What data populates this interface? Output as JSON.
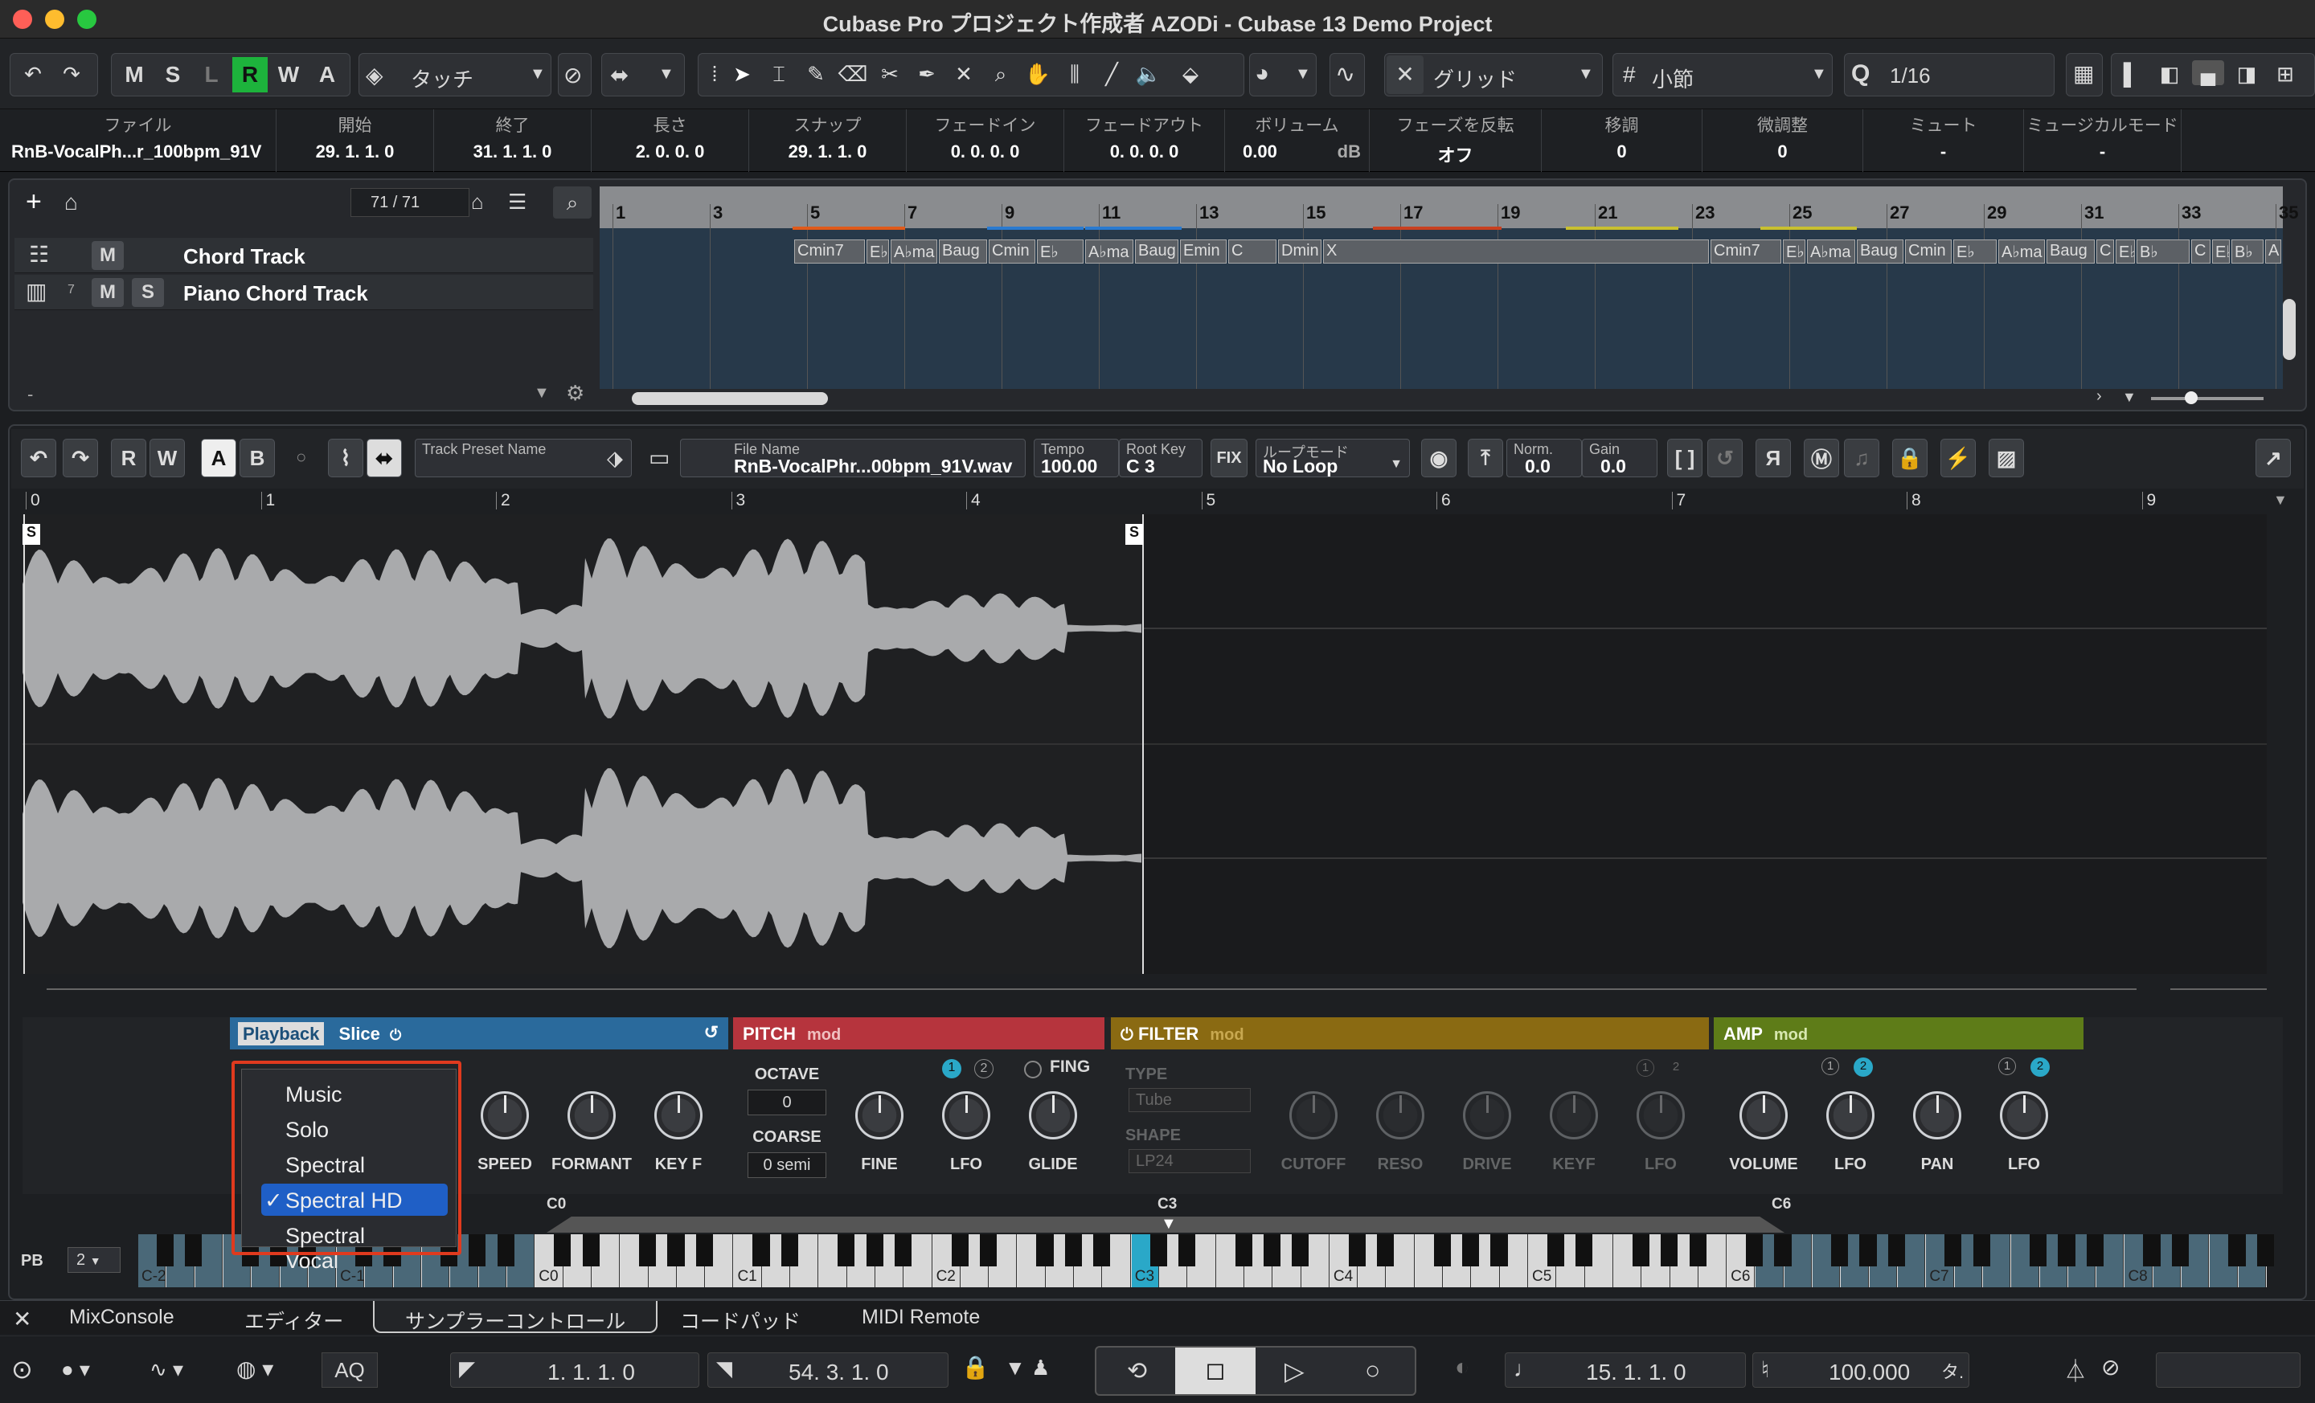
{
  "window": {
    "title": "Cubase Pro プロジェクト作成者 AZODi - Cubase 13 Demo Project"
  },
  "toolbar": {
    "modes": [
      "M",
      "S",
      "L",
      "R",
      "W",
      "A"
    ],
    "automation_mode": "タッチ",
    "snap_type": "グリッド",
    "grid_unit": "小節",
    "quantize": "1/16"
  },
  "infoline": [
    {
      "label": "ファイル",
      "value": "RnB-VocalPh...r_100bpm_91V"
    },
    {
      "label": "開始",
      "value": "29. 1. 1.   0"
    },
    {
      "label": "終了",
      "value": "31. 1. 1.   0"
    },
    {
      "label": "長さ",
      "value": "2. 0. 0.   0"
    },
    {
      "label": "スナップ",
      "value": "29. 1. 1.   0"
    },
    {
      "label": "フェードイン",
      "value": "0. 0. 0.   0"
    },
    {
      "label": "フェードアウト",
      "value": "0. 0. 0.   0"
    },
    {
      "label": "ボリューム",
      "value": "0.00",
      "unit": "dB"
    },
    {
      "label": "フェーズを反転",
      "value": "オフ"
    },
    {
      "label": "移調",
      "value": "0"
    },
    {
      "label": "微調整",
      "value": "0"
    },
    {
      "label": "ミュート",
      "value": "-"
    },
    {
      "label": "ミュージカルモード",
      "value": "-"
    }
  ],
  "project": {
    "track_count": "71 / 71",
    "tracks": [
      {
        "name": "Chord Track",
        "buttons": [
          "M"
        ]
      },
      {
        "name": "Piano Chord Track",
        "number": "7",
        "buttons": [
          "M",
          "S"
        ]
      }
    ],
    "ruler_bars": [
      "1",
      "3",
      "5",
      "7",
      "9",
      "11",
      "13",
      "15",
      "17",
      "19",
      "21",
      "23",
      "25",
      "27",
      "29",
      "31",
      "33",
      "35"
    ],
    "chords": [
      "Cmin7",
      "E♭",
      "A♭ma",
      "Baug",
      "Cmin",
      "E♭",
      "A♭ma",
      "Baug",
      "Emin",
      "C",
      "Dmin",
      "X",
      "Cmin7",
      "E♭",
      "A♭ma",
      "Baug",
      "Cmin",
      "E♭",
      "A♭ma",
      "Baug",
      "C",
      "E♭",
      "B♭",
      "C",
      "E♭",
      "B♭",
      "A"
    ],
    "dash": "-"
  },
  "editor": {
    "toolbar": {
      "r": "R",
      "w": "W",
      "a": "A",
      "b": "B",
      "track_preset_label": "Track Preset Name",
      "file_name_label": "File Name",
      "file_name": "RnB-VocalPhr...00bpm_91V.wav",
      "tempo_label": "Tempo",
      "tempo": "100.00",
      "root_key_label": "Root Key",
      "root_key": "C  3",
      "fix": "FIX",
      "loop_mode_label": "ループモード",
      "loop_mode": "No Loop",
      "norm_label": "Norm.",
      "norm": "0.0",
      "gain_label": "Gain",
      "gain": "0.0"
    },
    "ruler": [
      "0",
      "1",
      "2",
      "3",
      "4",
      "5",
      "6",
      "7",
      "8",
      "9"
    ],
    "markers": {
      "start": "S",
      "end": "S"
    },
    "playback": {
      "tab1": "Playback",
      "tab2": "Slice"
    },
    "pitch": {
      "title": "PITCH",
      "mod": "mod",
      "octave_label": "OCTAVE",
      "octave": "0",
      "coarse_label": "COARSE",
      "coarse": "0 semi",
      "fing": "FING",
      "lfo_1": "1",
      "lfo_2": "2"
    },
    "filter": {
      "title": "FILTER",
      "mod": "mod",
      "type_label": "TYPE",
      "type": "Tube",
      "shape_label": "SHAPE",
      "shape": "LP24",
      "lfo_1": "1",
      "lfo_2": "2"
    },
    "amp": {
      "title": "AMP",
      "mod": "mod",
      "lfo_1": "1",
      "lfo_2": "2",
      "lfo_3": "1",
      "lfo_4": "2"
    },
    "knobs": {
      "speed": "SPEED",
      "formant": "FORMANT",
      "keyf": "KEY F",
      "fine": "FINE",
      "lfo": "LFO",
      "glide": "GLIDE",
      "cutoff": "CUTOFF",
      "reso": "RESO",
      "drive": "DRIVE",
      "keyf2": "KEYF",
      "lfo_f": "LFO",
      "volume": "VOLUME",
      "lfo_a1": "LFO",
      "pan": "PAN",
      "lfo_a2": "LFO"
    },
    "keyboard": {
      "pb_label": "PB",
      "pb": "2",
      "c0": "C0",
      "c3": "C3",
      "c6": "C6",
      "notes": [
        "C-2",
        "C-1",
        "C0",
        "C1",
        "C2",
        "C3",
        "C4",
        "C5",
        "C6",
        "C7",
        "C8"
      ]
    }
  },
  "dropdown": {
    "items": [
      "Music",
      "Solo",
      "Spectral",
      "Spectral HD",
      "Spectral Vocal"
    ],
    "selected": "Spectral HD",
    "check": "✓"
  },
  "bottom_tabs": [
    "MixConsole",
    "エディター",
    "サンプラーコントロール",
    "コードパッド",
    "MIDI Remote"
  ],
  "transport": {
    "left_locator": "1.  1.  1.     0",
    "right_locator": "54.  3.  1.     0",
    "position": "15.  1.  1.     0",
    "tempo": "100.000",
    "signature": "タ.",
    "aq": "AQ"
  },
  "colors": {
    "record": "#1db33c",
    "playback": "#2a6a9c",
    "pitch": "#b6343d",
    "filter": "#8a6a12",
    "amp": "#5e7c18",
    "highlight": "#1f5fc6",
    "selected_key": "#2aa8c8",
    "annotation": "#e03a1e"
  }
}
